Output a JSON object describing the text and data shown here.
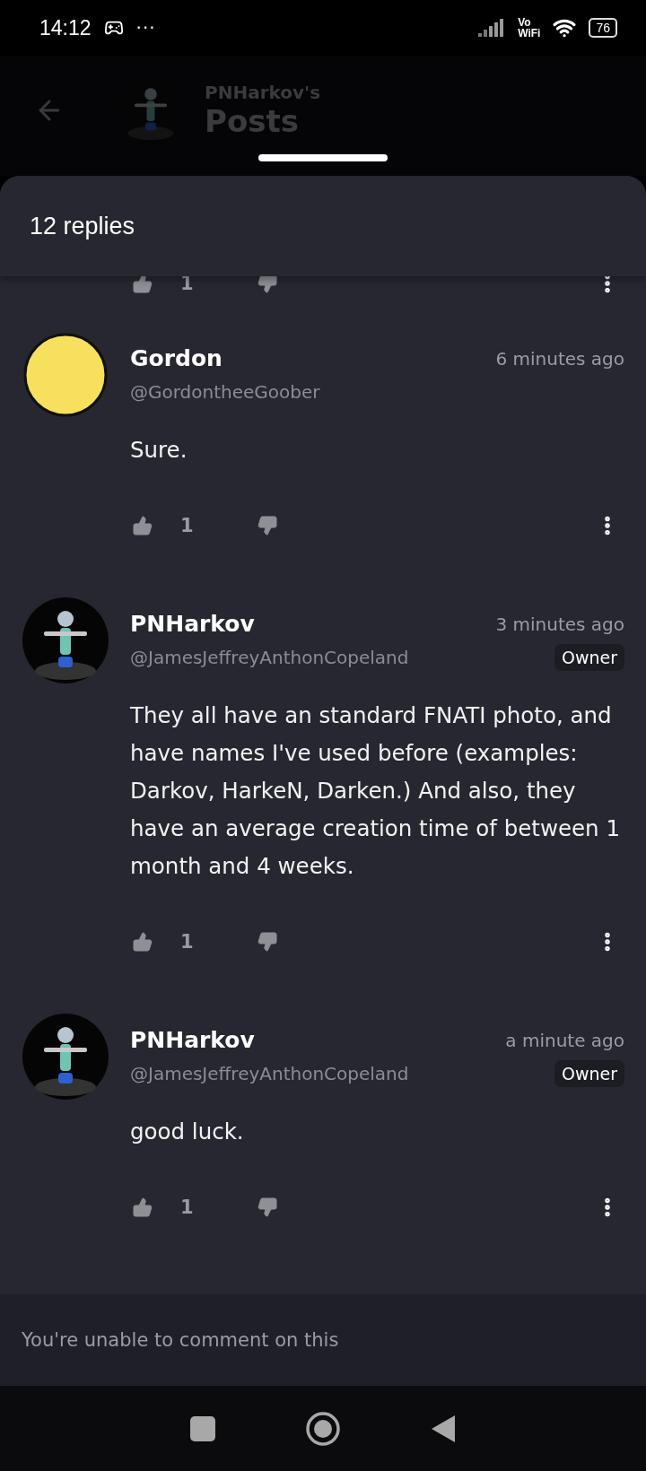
{
  "status_bar": {
    "time": "14:12",
    "more": "···",
    "network_top": "Vo",
    "network_bottom": "WiFi",
    "battery": "76"
  },
  "header": {
    "subtitle": "PNHarkov's",
    "title": "Posts"
  },
  "sheet": {
    "title": "12 replies"
  },
  "partial_actions": {
    "likes": "1"
  },
  "comments": [
    {
      "kind": "smiley",
      "name": "Gordon",
      "handle": "@GordontheeGoober",
      "time": "6 minutes ago",
      "owner": false,
      "body": "Sure.",
      "likes": "1"
    },
    {
      "kind": "figure",
      "name": "PNHarkov",
      "handle": "@JamesJeffreyAnthonCopeland",
      "time": "3 minutes ago",
      "owner": true,
      "badge": "Owner",
      "body": "They all have an standard FNATI photo, and have names I've used before (examples: Darkov, HarkeN, Darken.) And also, they have an average creation time of between 1 month and 4 weeks.",
      "likes": "1"
    },
    {
      "kind": "figure",
      "name": "PNHarkov",
      "handle": "@JamesJeffreyAnthonCopeland",
      "time": "a minute ago",
      "owner": true,
      "badge": "Owner",
      "body": "good luck.",
      "likes": "1"
    }
  ],
  "footer": {
    "notice": "You're unable to comment on this"
  }
}
